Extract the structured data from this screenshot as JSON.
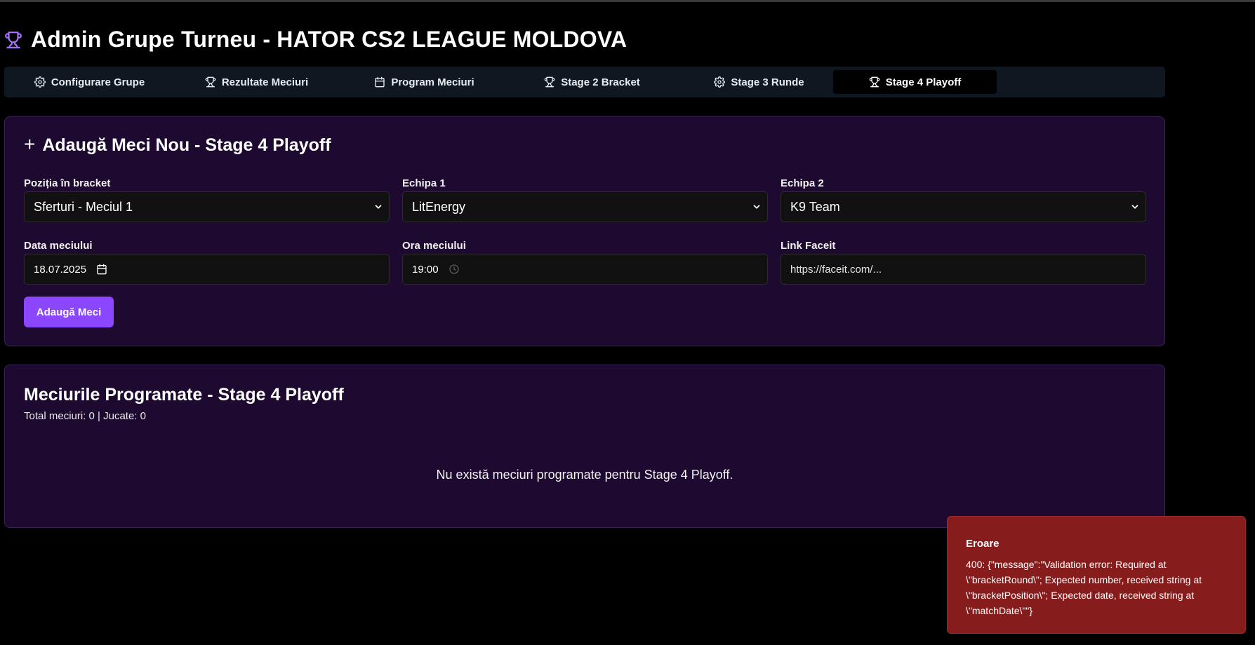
{
  "page": {
    "title": "Admin Grupe Turneu - HATOR CS2 LEAGUE MOLDOVA",
    "title_icon": "trophy-icon",
    "accent": "#8b46ff"
  },
  "tabs": [
    {
      "label": "Configurare Grupe",
      "icon": "gear-icon",
      "active": false
    },
    {
      "label": "Rezultate Meciuri",
      "icon": "trophy-icon",
      "active": false
    },
    {
      "label": "Program Meciuri",
      "icon": "calendar-icon",
      "active": false
    },
    {
      "label": "Stage 2 Bracket",
      "icon": "trophy-icon",
      "active": false
    },
    {
      "label": "Stage 3 Runde",
      "icon": "gear-icon",
      "active": false
    },
    {
      "label": "Stage 4 Playoff",
      "icon": "trophy-icon",
      "active": true
    }
  ],
  "add_form": {
    "title": "Adaugă Meci Nou - Stage 4 Playoff",
    "bracket_position": {
      "label": "Poziția în bracket",
      "value": "Sferturi - Meciul 1"
    },
    "team1": {
      "label": "Echipa 1",
      "value": "LitEnergy"
    },
    "team2": {
      "label": "Echipa 2",
      "value": "K9 Team"
    },
    "match_date": {
      "label": "Data meciului",
      "value": "18.07.2025"
    },
    "match_time": {
      "label": "Ora meciului",
      "value": "19:00"
    },
    "faceit_link": {
      "label": "Link Faceit",
      "placeholder": "https://faceit.com/..."
    },
    "submit_label": "Adaugă Meci"
  },
  "matches": {
    "title": "Meciurile Programate - Stage 4 Playoff",
    "summary": "Total meciuri: 0 | Jucate: 0",
    "empty_message": "Nu există meciuri programate pentru Stage 4 Playoff."
  },
  "toast": {
    "title": "Eroare",
    "message": "400: {\"message\":\"Validation error: Required at \\\"bracketRound\\\"; Expected number, received string at \\\"bracketPosition\\\"; Expected date, received string at \\\"matchDate\\\"\"}",
    "color": "#861c1c"
  }
}
